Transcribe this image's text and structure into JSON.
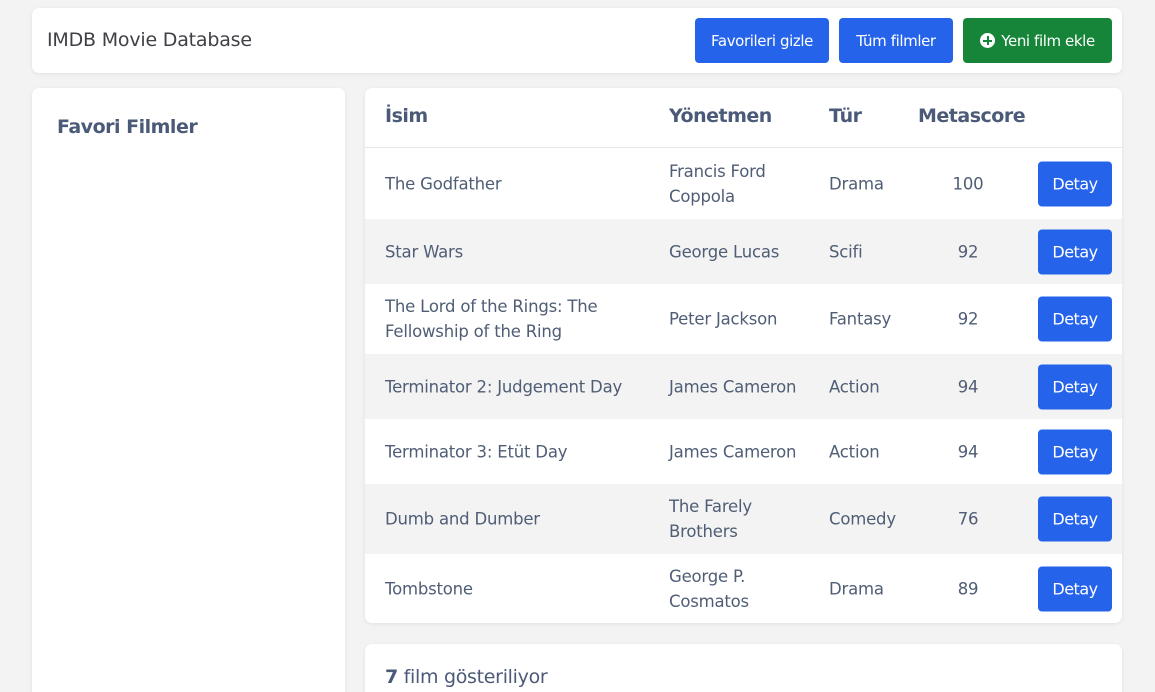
{
  "header": {
    "title": "IMDB Movie Database",
    "hide_favorites_label": "Favorileri gizle",
    "all_movies_label": "Tüm filmler",
    "add_movie_label": "Yeni film ekle"
  },
  "sidebar": {
    "title": "Favori Filmler"
  },
  "table": {
    "columns": [
      "İsim",
      "Yönetmen",
      "Tür",
      "Metascore"
    ],
    "detail_label": "Detay",
    "rows": [
      {
        "name": "The Godfather",
        "director": "Francis Ford Coppola",
        "genre": "Drama",
        "metascore": "100"
      },
      {
        "name": "Star Wars",
        "director": "George Lucas",
        "genre": "Scifi",
        "metascore": "92"
      },
      {
        "name": "The Lord of the Rings: The Fellowship of the Ring",
        "director": "Peter Jackson",
        "genre": "Fantasy",
        "metascore": "92"
      },
      {
        "name": "Terminator 2: Judgement Day",
        "director": "James Cameron",
        "genre": "Action",
        "metascore": "94"
      },
      {
        "name": "Terminator 3: Etüt Day",
        "director": "James Cameron",
        "genre": "Action",
        "metascore": "94"
      },
      {
        "name": "Dumb and Dumber",
        "director": "The Farely Brothers",
        "genre": "Comedy",
        "metascore": "76"
      },
      {
        "name": "Tombstone",
        "director": "George P. Cosmatos",
        "genre": "Drama",
        "metascore": "89"
      }
    ]
  },
  "footer": {
    "count": "7",
    "text": " film gösteriliyor"
  },
  "colors": {
    "primary": "#2563eb",
    "success": "#16853a",
    "background": "#f3f3f3",
    "heading": "#4a5a78"
  }
}
